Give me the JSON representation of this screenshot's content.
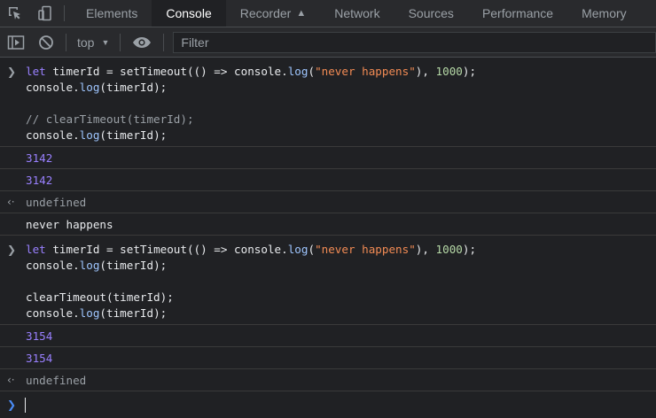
{
  "tabs": [
    {
      "label": "Elements",
      "active": false
    },
    {
      "label": "Console",
      "active": true
    },
    {
      "label": "Recorder",
      "active": false
    },
    {
      "label": "Network",
      "active": false
    },
    {
      "label": "Sources",
      "active": false
    },
    {
      "label": "Performance",
      "active": false
    },
    {
      "label": "Memory",
      "active": false
    }
  ],
  "toolbar": {
    "context": "top",
    "filter_placeholder": "Filter"
  },
  "icons": {
    "inspect": "inspect-element-icon",
    "device": "device-toolbar-icon",
    "sidebar": "show-sidebar-icon",
    "clear": "clear-console-icon",
    "eye": "live-expression-icon",
    "recorder": "flask-icon"
  },
  "console": {
    "block1": {
      "l1": {
        "a": "let",
        "b": " timerId = setTimeout(() => console.",
        "c": "log",
        "d": "(",
        "e": "\"never happens\"",
        "f": "), ",
        "g": "1000",
        "h": ");"
      },
      "l2": {
        "a": "console.",
        "b": "log",
        "c": "(timerId);"
      },
      "l3": "// clearTimeout(timerId);",
      "l4": {
        "a": "console.",
        "b": "log",
        "c": "(timerId);"
      }
    },
    "out1": "3142",
    "out2": "3142",
    "ret1": "undefined",
    "log1": "never happens",
    "block2": {
      "l1": {
        "a": "let",
        "b": " timerId = setTimeout(() => console.",
        "c": "log",
        "d": "(",
        "e": "\"never happens\"",
        "f": "), ",
        "g": "1000",
        "h": ");"
      },
      "l2": {
        "a": "console.",
        "b": "log",
        "c": "(timerId);"
      },
      "l3": "clearTimeout(timerId);",
      "l4": {
        "a": "console.",
        "b": "log",
        "c": "(timerId);"
      }
    },
    "out3": "3154",
    "out4": "3154",
    "ret2": "undefined"
  },
  "colors": {
    "background": "#202124",
    "toolbar": "#292a2d",
    "keyword": "#9980ff",
    "string": "#f28b54",
    "number_literal": "#b5d8a6",
    "method": "#9ec5fe",
    "prompt": "#4a8cf7"
  }
}
